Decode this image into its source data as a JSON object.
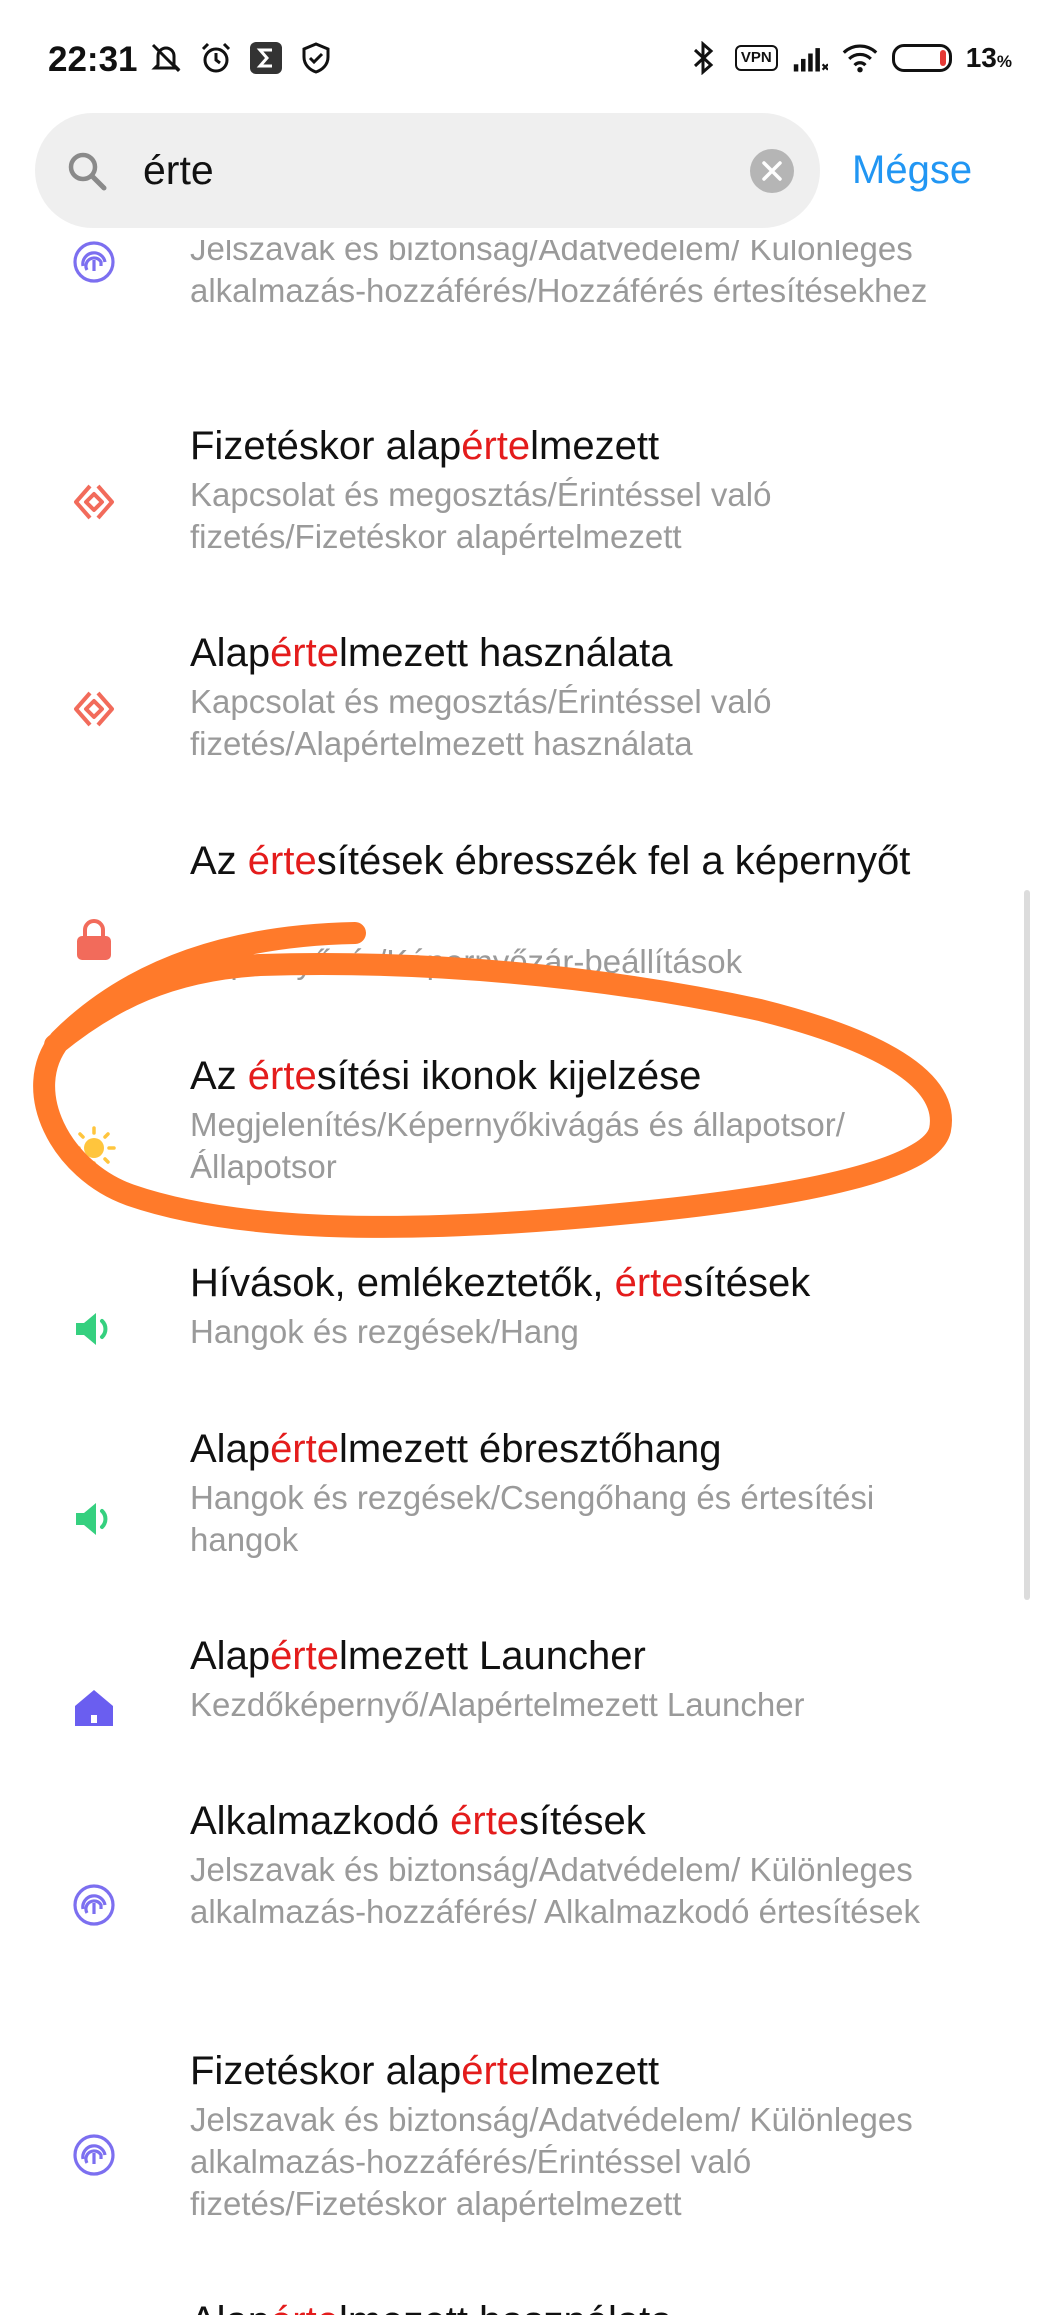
{
  "status": {
    "time": "22:31",
    "vpn": "VPN",
    "battery_percent": "13",
    "battery_unit": "%",
    "battery_level": 0.13,
    "icons_left": [
      "mute-icon",
      "alarm-icon",
      "sigma-app-icon",
      "shield-icon"
    ],
    "icons_right": [
      "bluetooth-icon",
      "vpn-icon",
      "signal-icon",
      "wifi-icon",
      "battery-icon"
    ]
  },
  "search": {
    "value": "érte",
    "cancel_label": "Mégse"
  },
  "accent": "#2196f3",
  "highlight_color": "#e41c1c",
  "annotation_color": "#ff7a2a",
  "results": [
    {
      "icon": "fingerprint-icon",
      "title_parts": [
        "",
        "",
        ""
      ],
      "subtitle": "Jelszavak és biztonság/Adatvédelem/ Különleges alkalmazás-hozzáférés/Hozzáférés értesítésekhez"
    },
    {
      "icon": "nfc-icon",
      "title_parts": [
        "Fizetéskor alap",
        "érte",
        "lmezett"
      ],
      "subtitle": "Kapcsolat és megosztás/Érintéssel való fizetés/Fizetéskor alapértelmezett"
    },
    {
      "icon": "nfc-icon",
      "title_parts": [
        "Alap",
        "érte",
        "lmezett használata"
      ],
      "subtitle": "Kapcsolat és megosztás/Érintéssel való fizetés/Alapértelmezett használata"
    },
    {
      "icon": "lock-icon",
      "title_parts": [
        "Az ",
        "érte",
        "sítések ébresszék fel a képernyőt"
      ],
      "subtitle": "Képernyőzár/Képernyőzár-beállítások"
    },
    {
      "icon": "sun-icon",
      "title_parts": [
        "Az ",
        "érte",
        "sítési ikonok kijelzése"
      ],
      "subtitle": "Megjelenítés/Képernyőkivágás és állapotsor/ Állapotsor"
    },
    {
      "icon": "speaker-icon",
      "title_parts": [
        "Hívások, emlékeztetők, ",
        "érte",
        "sítések"
      ],
      "subtitle": "Hangok és rezgések/Hang"
    },
    {
      "icon": "speaker-icon",
      "title_parts": [
        "Alap",
        "érte",
        "lmezett ébresztőhang"
      ],
      "subtitle": "Hangok és rezgések/Csengőhang és értesítési hangok"
    },
    {
      "icon": "home-icon",
      "title_parts": [
        "Alap",
        "érte",
        "lmezett Launcher"
      ],
      "subtitle": "Kezdőképernyő/Alapértelmezett Launcher"
    },
    {
      "icon": "fingerprint-icon",
      "title_parts": [
        "Alkalmazkodó ",
        "érte",
        "sítések"
      ],
      "subtitle": "Jelszavak és biztonság/Adatvédelem/ Különleges alkalmazás-hozzáférés/ Alkalmazkodó értesítések"
    },
    {
      "icon": "fingerprint-icon",
      "title_parts": [
        "Fizetéskor alap",
        "érte",
        "lmezett"
      ],
      "subtitle": "Jelszavak és biztonság/Adatvédelem/ Különleges alkalmazás-hozzáférés/Érintéssel való fizetés/Fizetéskor alapértelmezett"
    },
    {
      "icon": "",
      "title_parts": [
        "Alap",
        "érte",
        "lmezett használata"
      ],
      "subtitle": ""
    }
  ]
}
